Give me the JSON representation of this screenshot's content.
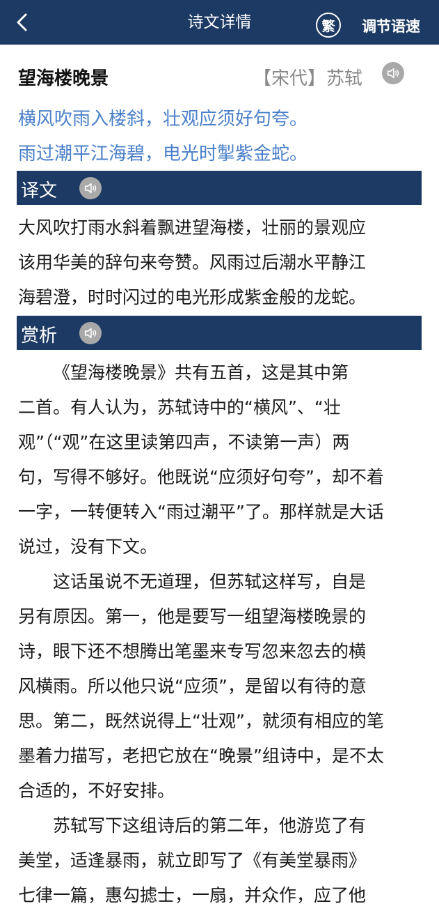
{
  "header": {
    "title": "诗文详情",
    "traditional_label": "繁",
    "speed_label": "调节语速"
  },
  "poem": {
    "title": "望海楼晚景",
    "dynasty": "【宋代】",
    "author": "苏轼",
    "lines": [
      "横风吹雨入楼斜，壮观应须好句夸。",
      "雨过潮平江海碧，电光时掣紫金蛇。"
    ]
  },
  "translation": {
    "label": "译文",
    "lines": [
      "大风吹打雨水斜着飘进望海楼，壮丽的景观应",
      "该用华美的辞句来夸赞。风雨过后潮水平静江",
      "海碧澄，时时闪过的电光形成紫金般的龙蛇。"
    ]
  },
  "appreciation": {
    "label": "赏析",
    "lines": [
      "《望海楼晚景》共有五首，这是其中第",
      "二首。有人认为，苏轼诗中的“横风”、“壮",
      "观”（“观”在这里读第四声，不读第一声）两",
      "句，写得不够好。他既说“应须好句夸”，却不着",
      "一字，一转便转入“雨过潮平”了。那样就是大话",
      "说过，没有下文。",
      "这话虽说不无道理，但苏轼这样写，自是",
      "另有原因。第一，他是要写一组望海楼晚景的",
      "诗，眼下还不想腾出笔墨来专写忽来忽去的横",
      "风横雨。所以他只说“应须”，是留以有待的意",
      "思。第二，既然说得上“壮观”，就须有相应的笔",
      "墨着力描写，老把它放在“晚景”组诗中，是不太",
      "合适的，不好安排。",
      "苏轼写下这组诗后的第二年，他游览了有",
      "美堂，适逢暴雨，就立即写了《有美堂暴雨》",
      "七律一篇，惠勾摅士，一扇，并众作，应了他"
    ]
  }
}
